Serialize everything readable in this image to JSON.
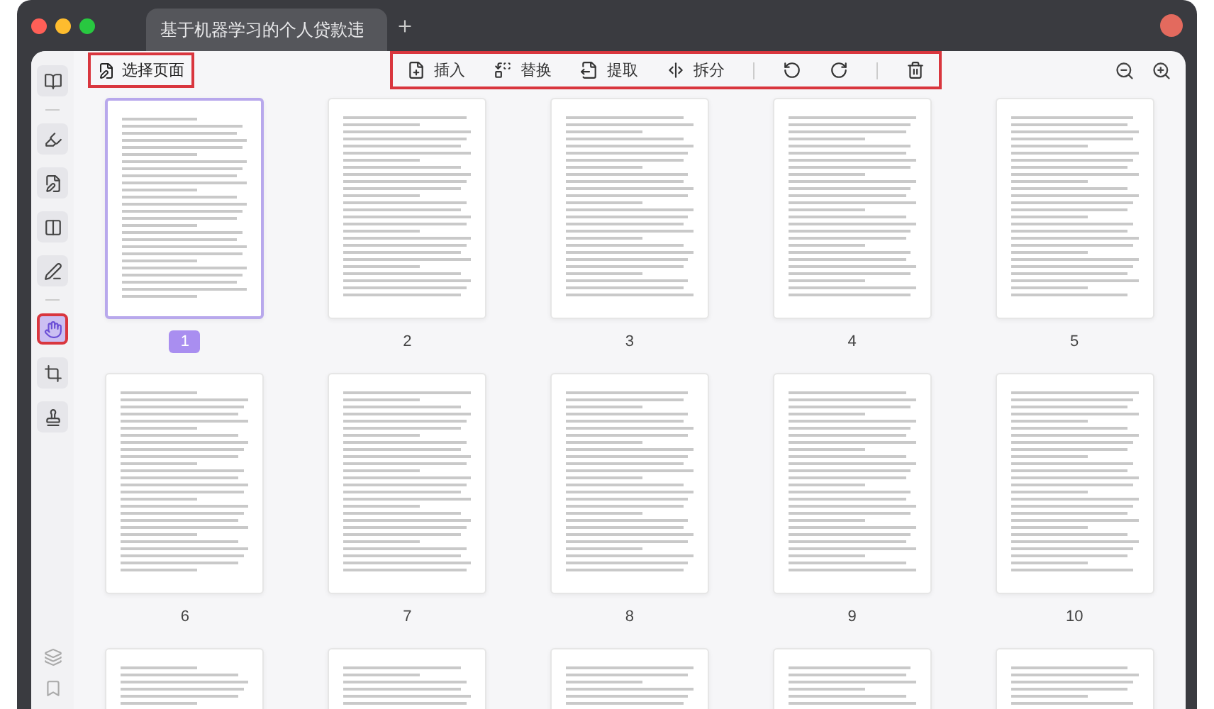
{
  "window": {
    "tab_title": "基于机器学习的个人贷款违"
  },
  "sidebar": {
    "groups": [
      [
        {
          "kind": "reader",
          "selected": false,
          "highlighted": false
        }
      ],
      [
        {
          "kind": "highlighter",
          "selected": false,
          "highlighted": false
        },
        {
          "kind": "edit",
          "selected": false,
          "highlighted": false
        },
        {
          "kind": "form",
          "selected": false,
          "highlighted": false
        },
        {
          "kind": "sign",
          "selected": false,
          "highlighted": false
        }
      ],
      [
        {
          "kind": "organize",
          "selected": true,
          "highlighted": true
        },
        {
          "kind": "crop",
          "selected": false,
          "highlighted": false
        },
        {
          "kind": "watermark",
          "selected": false,
          "highlighted": false
        }
      ]
    ],
    "bottom_items": [
      {
        "kind": "layers"
      },
      {
        "kind": "bookmark"
      }
    ]
  },
  "toolbar": {
    "select_pages": {
      "label": "选择页面",
      "highlighted": true
    },
    "tools_highlighted": true,
    "tools": [
      {
        "kind": "insert",
        "label": "插入"
      },
      {
        "kind": "replace",
        "label": "替换"
      },
      {
        "kind": "extract",
        "label": "提取"
      },
      {
        "kind": "split",
        "label": "拆分"
      },
      {
        "kind": "separator"
      },
      {
        "kind": "rotate-left"
      },
      {
        "kind": "rotate-right"
      },
      {
        "kind": "separator"
      },
      {
        "kind": "delete"
      }
    ]
  },
  "pages": [
    {
      "label": "1",
      "selected": true
    },
    {
      "label": "2",
      "selected": false
    },
    {
      "label": "3",
      "selected": false
    },
    {
      "label": "4",
      "selected": false
    },
    {
      "label": "5",
      "selected": false
    },
    {
      "label": "6",
      "selected": false
    },
    {
      "label": "7",
      "selected": false
    },
    {
      "label": "8",
      "selected": false
    },
    {
      "label": "9",
      "selected": false
    },
    {
      "label": "10",
      "selected": false
    },
    {
      "selected": false
    },
    {
      "selected": false
    },
    {
      "selected": false
    },
    {
      "selected": false
    },
    {
      "selected": false
    }
  ]
}
